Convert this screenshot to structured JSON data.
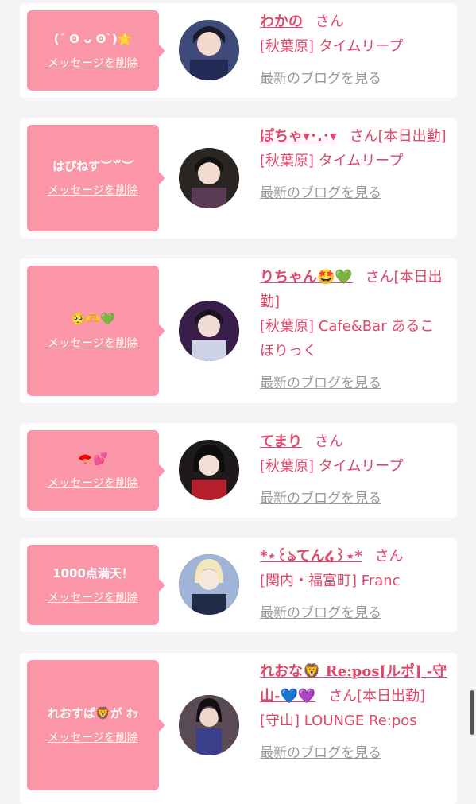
{
  "favorites": [
    {
      "message": "(ˊ ʘ ᴗ ʘˋ)🌟",
      "delete_label": "メッセージを削除",
      "name": "わかの",
      "suffix": "さん",
      "area": "[秋葉原] タイムリープ",
      "blog_label": "最新のブログを見る"
    },
    {
      "message": "はぴねす︶꒳︶",
      "delete_label": "メッセージを削除",
      "name": "ぽちゃ▾･.･▾",
      "suffix": "さん[本日出勤]",
      "area": "[秋葉原] タイムリープ",
      "blog_label": "最新のブログを見る"
    },
    {
      "message": "🥺🫶💚",
      "delete_label": "メッセージを削除",
      "name": "りちゃん🤩💚",
      "suffix": "さん[本日出勤]",
      "area": "[秋葉原] Cafe&Bar あるこほりっく",
      "blog_label": "最新のブログを見る"
    },
    {
      "message": "🪭💕",
      "delete_label": "メッセージを削除",
      "name": "てまり",
      "suffix": "さん",
      "area": "[秋葉原] タイムリープ",
      "blog_label": "最新のブログを見る"
    },
    {
      "message": "1000点満天！",
      "delete_label": "メッセージを削除",
      "name": "*⋆꒰ঌてん໒꒱⋆*",
      "suffix": "さん",
      "area": "[関内・福富町] Franc",
      "blog_label": "最新のブログを見る"
    },
    {
      "message": "れおすぱ🦁が ｵｯ",
      "delete_label": "メッセージを削除",
      "name": "れおな🦁 Re:pos[ルポ] -守山-💙💜",
      "suffix": "さん[本日出勤]",
      "area": "[守山] LOUNGE Re:pos",
      "blog_label": "最新のブログを見る"
    }
  ]
}
